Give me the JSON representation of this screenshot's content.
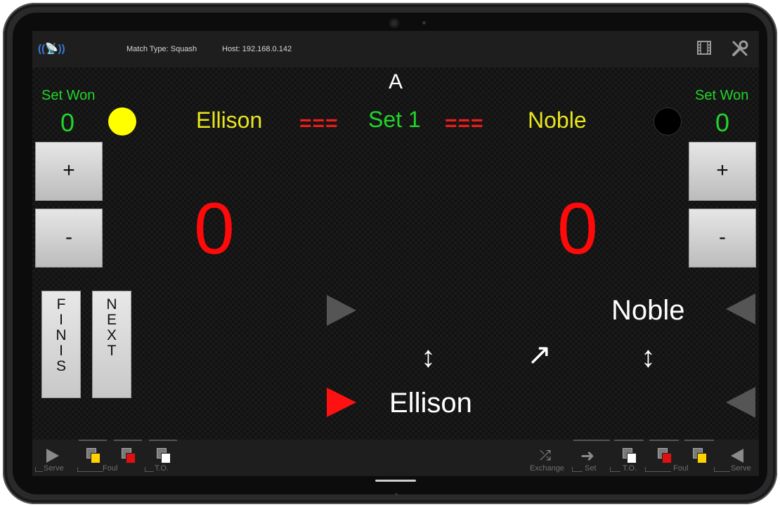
{
  "topbar": {
    "broadcast_icon": "((📡))",
    "match_type": "Match Type: Squash",
    "host": "Host: 192.168.0.142",
    "icons": [
      "film-icon",
      "tools-icon"
    ]
  },
  "court_label": "A",
  "set": {
    "label": "Set 1",
    "separator": "==="
  },
  "left_player": {
    "name": "Ellison",
    "set_won_label": "Set Won",
    "sets_won": "0",
    "score": "0",
    "ball_color": "#ffff00"
  },
  "right_player": {
    "name": "Noble",
    "set_won_label": "Set Won",
    "sets_won": "0",
    "score": "0",
    "ball_color": "#000000"
  },
  "buttons": {
    "plus": "+",
    "minus": "-",
    "finish_letters": [
      "F",
      "I",
      "N",
      "I",
      "S"
    ],
    "next_letters": [
      "N",
      "E",
      "X",
      "T"
    ]
  },
  "serve_panel": {
    "top_name": "Noble",
    "bottom_name": "Ellison",
    "active_arrow_color": "#ff1111",
    "inactive_arrow_color": "#555555"
  },
  "bottombar": {
    "left": {
      "serve": "Serve",
      "foul": "Foul",
      "timeout": "T.O."
    },
    "right": {
      "exchange": "Exchange",
      "set": "Set",
      "timeout": "T.O.",
      "foul": "Foul",
      "serve": "Serve"
    },
    "card_colors": {
      "yellow": "#ffd200",
      "red": "#e01010",
      "white": "#ffffff"
    }
  }
}
